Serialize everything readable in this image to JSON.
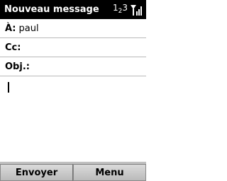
{
  "titlebar": {
    "title": "Nouveau message",
    "input_mode_main": "1",
    "input_mode_sub": "2",
    "input_mode_tail": "3",
    "signal_icon": "signal-strength-icon"
  },
  "fields": {
    "to_label": "À:",
    "to_value": "paul",
    "cc_label": "Cc:",
    "cc_value": "",
    "subject_label": "Obj.:",
    "subject_value": ""
  },
  "body": {
    "text": ""
  },
  "softkeys": {
    "left_label": "Envoyer",
    "right_label": "Menu"
  }
}
